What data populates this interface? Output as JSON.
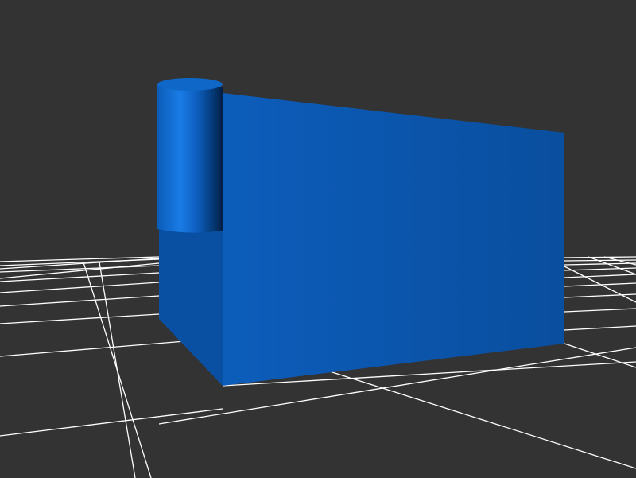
{
  "scene": {
    "background_color": "#333333",
    "grid_color": "#ffffff",
    "grid_visible": true,
    "objects": [
      {
        "name": "box",
        "shape": "rectangular box",
        "color": "#0a5ab0"
      },
      {
        "name": "cylinder",
        "shape": "vertical cylinder",
        "color": "#1673d6"
      }
    ]
  }
}
